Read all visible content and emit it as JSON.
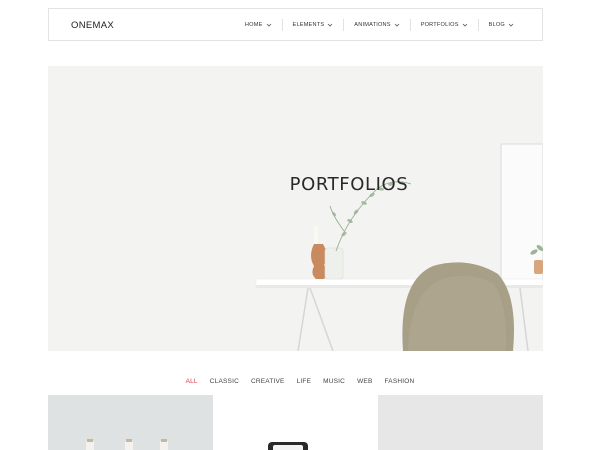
{
  "header": {
    "logo": "ONEMAX",
    "nav": [
      {
        "label": "HOME"
      },
      {
        "label": "ELEMENTS"
      },
      {
        "label": "ANIMATIONS"
      },
      {
        "label": "PORTFOLIOS"
      },
      {
        "label": "BLOG"
      }
    ]
  },
  "hero": {
    "title": "PORTFOLIOS"
  },
  "filters": [
    {
      "label": "ALL",
      "active": true
    },
    {
      "label": "CLASSIC"
    },
    {
      "label": "CREATIVE"
    },
    {
      "label": "LIFE"
    },
    {
      "label": "MUSIC"
    },
    {
      "label": "WEB"
    },
    {
      "label": "FASHION"
    }
  ],
  "colors": {
    "accent": "#e0404a",
    "border": "#e3e3e3",
    "chair": "#a89f87"
  },
  "portfolio_tiles": [
    {
      "image": "bottles"
    },
    {
      "image": "watch"
    },
    {
      "image": "blank"
    }
  ]
}
